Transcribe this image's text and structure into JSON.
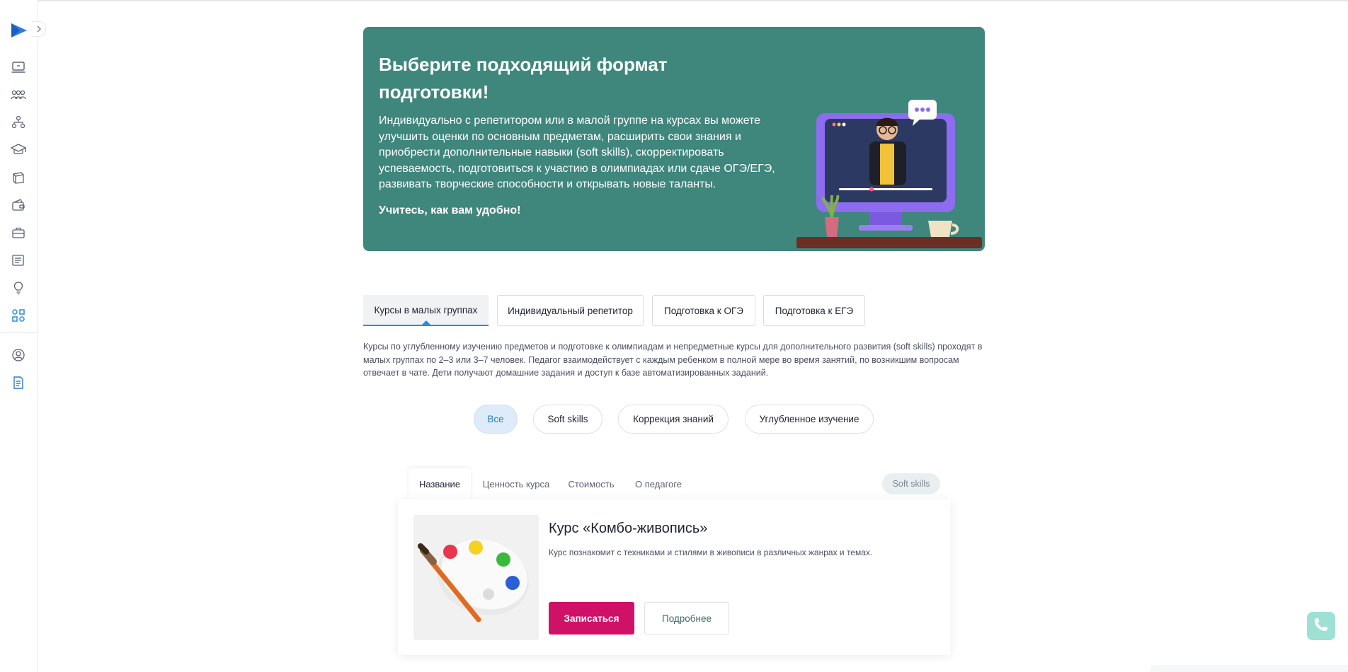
{
  "sidebar": {
    "logo_icon": "play-logo-icon",
    "expand_icon": "chevron-right-icon",
    "items": [
      {
        "icon": "laptop-icon"
      },
      {
        "icon": "group-icon"
      },
      {
        "icon": "hierarchy-icon"
      },
      {
        "icon": "graduation-cap-icon"
      },
      {
        "icon": "book-icon"
      },
      {
        "icon": "wallet-icon"
      },
      {
        "icon": "briefcase-icon"
      },
      {
        "icon": "newspaper-icon"
      },
      {
        "icon": "lightbulb-icon"
      },
      {
        "icon": "apps-icon",
        "active": true
      },
      {
        "icon": "profile-icon"
      },
      {
        "icon": "document-icon"
      }
    ]
  },
  "hero": {
    "title": "Выберите подходящий формат подготовки!",
    "description": "Индивидуально с репетитором или в малой группе на курсах вы можете улучшить оценки по основным предметам, расширить свои знания и приобрести дополнительные навыки (soft skills), скорректировать успеваемость, подготовиться к участию в олимпиадах или сдаче ОГЭ/ЕГЭ, развивать творческие способности и открывать новые таланты.",
    "tagline": "Учитесь, как вам удобно!",
    "illustration": "teacher-on-monitor-illustration"
  },
  "program_tabs": [
    {
      "label": "Курсы в малых группах",
      "active": true
    },
    {
      "label": "Индивидуальный репетитор"
    },
    {
      "label": "Подготовка к ОГЭ"
    },
    {
      "label": "Подготовка к ЕГЭ"
    }
  ],
  "program_description": "Курсы по углубленному изучению предметов и подготовке к олимпиадам и непредметные курсы для дополнительного развития (soft skills) проходят в малых группах по 2–3 или 3–7 человек. Педагог взаимодействует с каждым ребенком в полной мере во время занятий, по возникшим вопросам отвечает в чате. Дети получают домашние задания и доступ к базе автоматизированных заданий.",
  "filters": [
    {
      "label": "Все",
      "active": true
    },
    {
      "label": "Soft skills"
    },
    {
      "label": "Коррекция знаний"
    },
    {
      "label": "Углубленное изучение"
    }
  ],
  "course": {
    "tabs": [
      {
        "label": "Название",
        "active": true
      },
      {
        "label": "Ценность курса"
      },
      {
        "label": "Стоимость"
      },
      {
        "label": "О педагоге"
      }
    ],
    "tag": "Soft skills",
    "image": "paint-palette-image",
    "title": "Курс «Комбо-живопись»",
    "description": "Курс познакомит с техниками и стилями в живописи в различных жанрах и темах.",
    "enroll_label": "Записаться",
    "details_label": "Подробнее"
  },
  "call_button_icon": "phone-icon",
  "colors": {
    "hero_bg": "#3f867d",
    "accent_blue": "#2a8cd8",
    "primary_button": "#d01168"
  }
}
